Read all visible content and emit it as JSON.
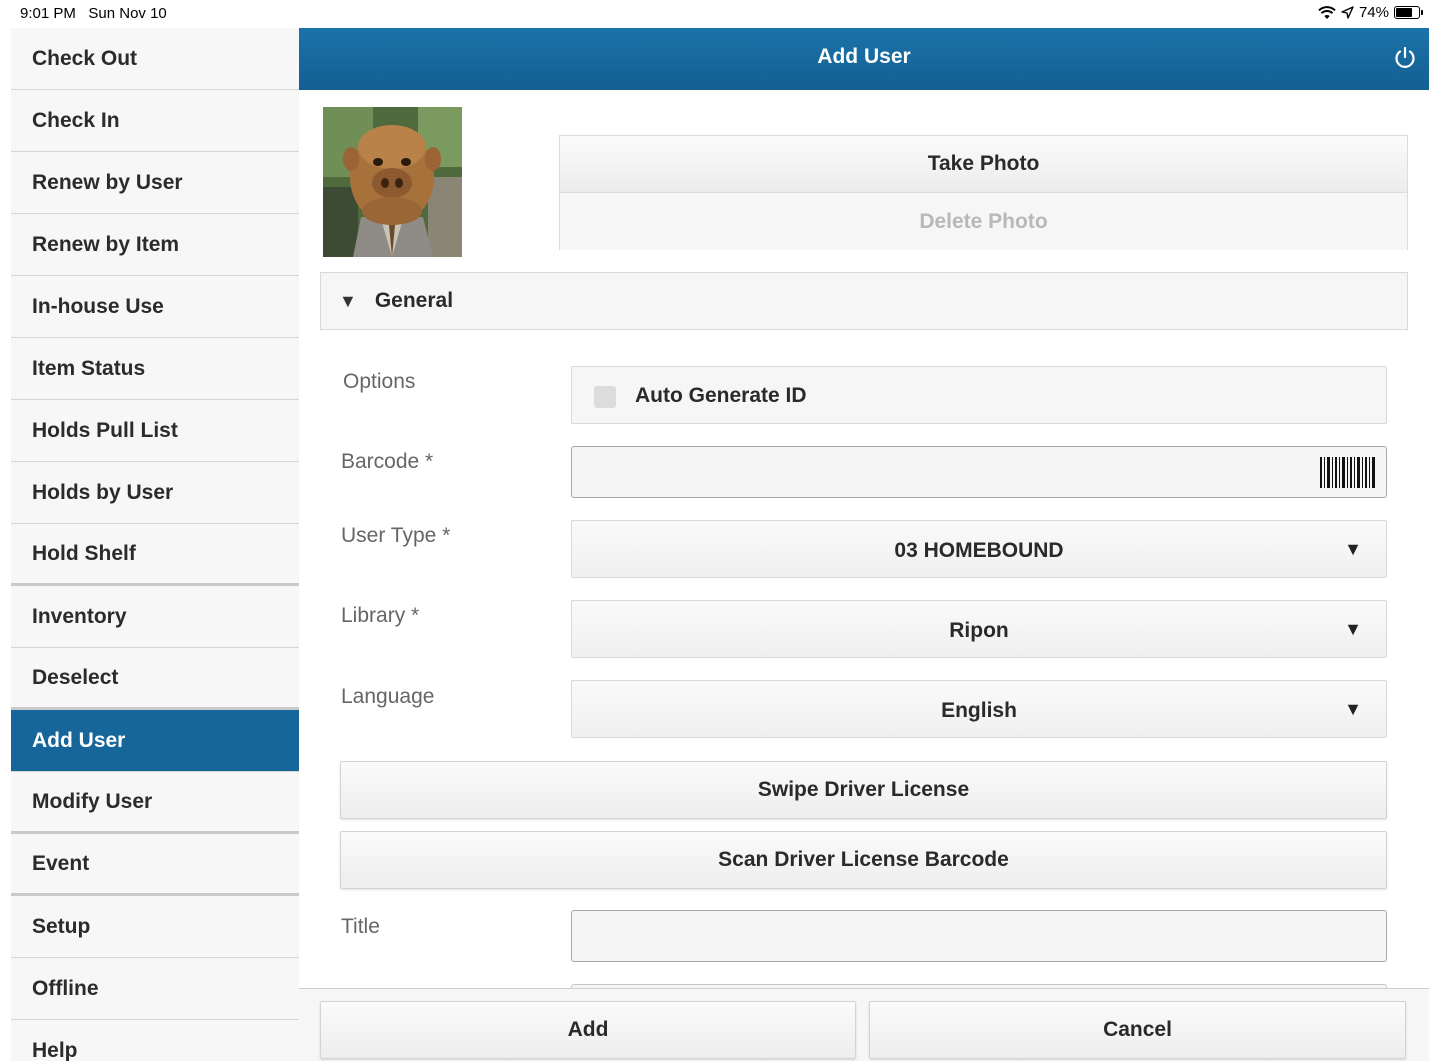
{
  "status_bar": {
    "time": "9:01 PM",
    "date": "Sun Nov 10",
    "battery": "74%",
    "icons": [
      "wifi-icon",
      "location-arrow-icon",
      "battery-icon"
    ]
  },
  "sidebar": {
    "items": [
      {
        "label": "Check Out"
      },
      {
        "label": "Check In"
      },
      {
        "label": "Renew by User"
      },
      {
        "label": "Renew by Item"
      },
      {
        "label": "In-house Use"
      },
      {
        "label": "Item Status"
      },
      {
        "label": "Holds Pull List"
      },
      {
        "label": "Holds by User"
      },
      {
        "label": "Hold Shelf"
      },
      {
        "label": "Inventory"
      },
      {
        "label": "Deselect"
      },
      {
        "label": "Add User"
      },
      {
        "label": "Modify User"
      },
      {
        "label": "Event"
      },
      {
        "label": "Setup"
      },
      {
        "label": "Offline"
      },
      {
        "label": "Help"
      }
    ],
    "active": "Add User"
  },
  "header": {
    "title": "Add User",
    "power_icon": "power-icon"
  },
  "photo": {
    "take_label": "Take Photo",
    "delete_label": "Delete Photo"
  },
  "section": {
    "label": "General",
    "icon": "triangle-down",
    "toggle_glyph": "▼"
  },
  "form": {
    "options_label": "Options",
    "auto_generate_label": "Auto Generate ID",
    "barcode_label": "Barcode *",
    "barcode_value": "",
    "user_type_label": "User Type *",
    "user_type_value": "03 HOMEBOUND",
    "library_label": "Library *",
    "library_value": "Ripon",
    "language_label": "Language",
    "language_value": "English",
    "dropdown_glyph": "▼",
    "swipe_label": "Swipe Driver License",
    "scan_label": "Scan Driver License Barcode",
    "title_label": "Title",
    "title_value": ""
  },
  "footer": {
    "add_label": "Add",
    "cancel_label": "Cancel"
  },
  "colors": {
    "accent": "#16669a",
    "header": "#1b73aa",
    "sidebar_bg": "#f7f7f7"
  }
}
